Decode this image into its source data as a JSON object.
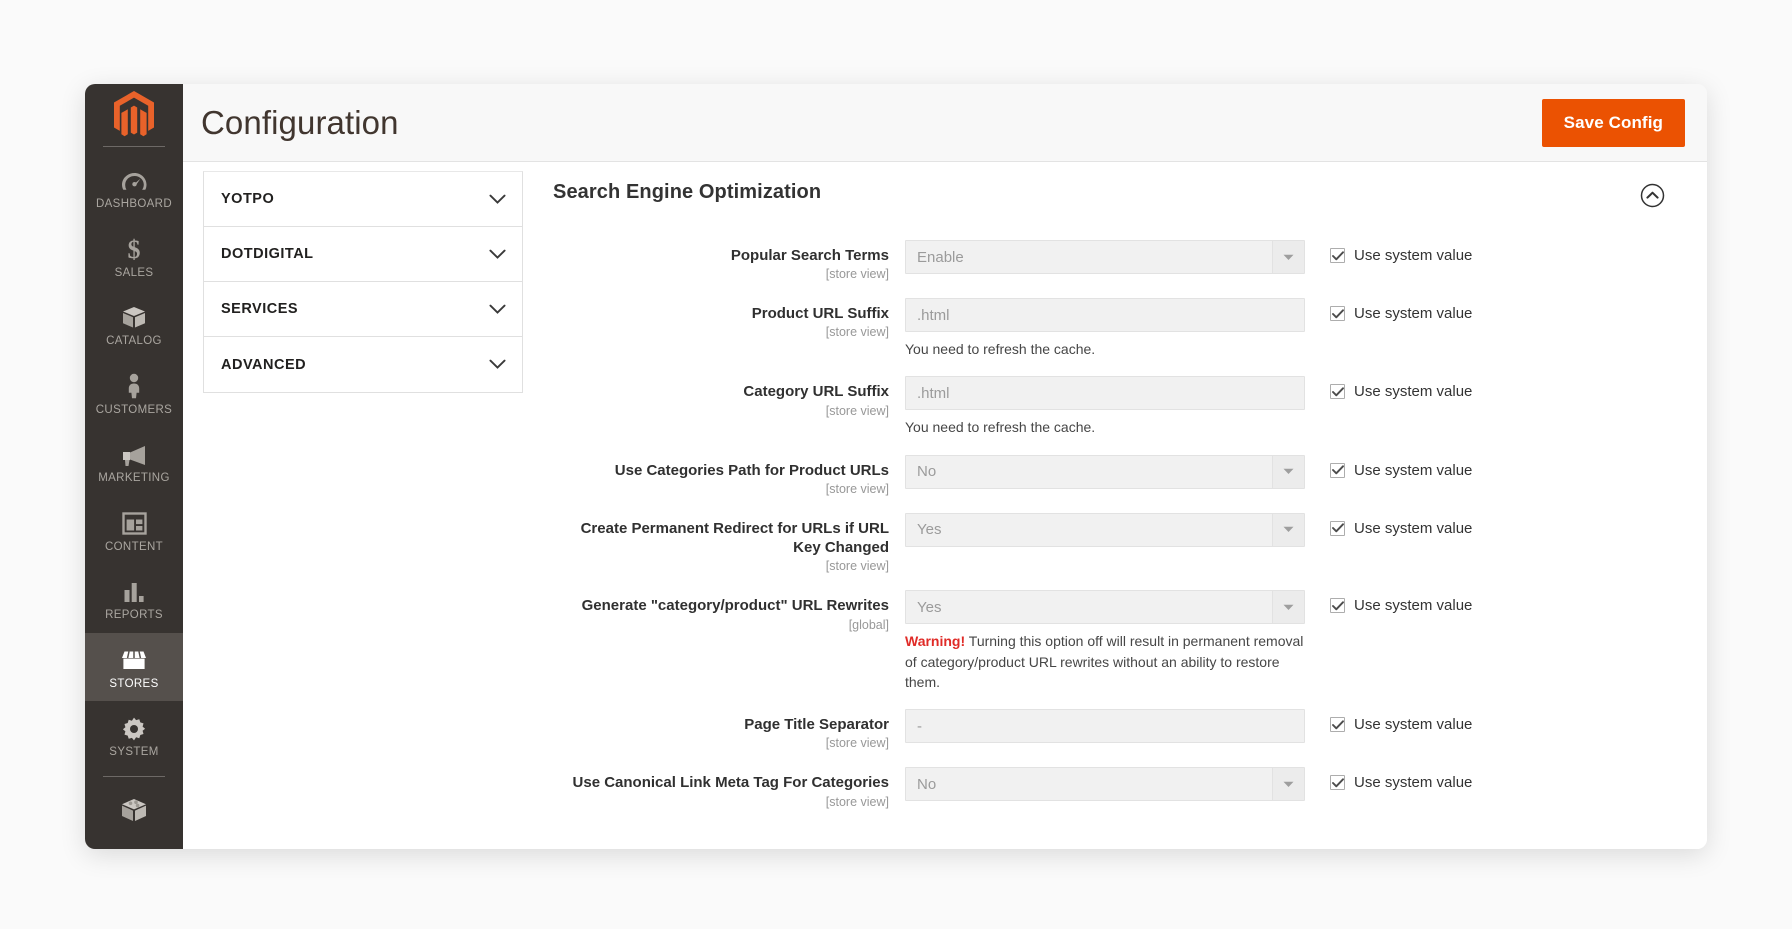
{
  "header": {
    "title": "Configuration",
    "save_label": "Save Config",
    "accent_color": "#eb5202"
  },
  "sidebar": {
    "logo": "magento-logo",
    "items": [
      {
        "label": "DASHBOARD",
        "icon": "dashboard-icon",
        "active": false
      },
      {
        "label": "SALES",
        "icon": "dollar-icon",
        "active": false
      },
      {
        "label": "CATALOG",
        "icon": "box-icon",
        "active": false
      },
      {
        "label": "CUSTOMERS",
        "icon": "person-icon",
        "active": false
      },
      {
        "label": "MARKETING",
        "icon": "megaphone-icon",
        "active": false
      },
      {
        "label": "CONTENT",
        "icon": "layout-icon",
        "active": false
      },
      {
        "label": "REPORTS",
        "icon": "bar-chart-icon",
        "active": false
      },
      {
        "label": "STORES",
        "icon": "store-icon",
        "active": true
      },
      {
        "label": "SYSTEM",
        "icon": "gear-icon",
        "active": false
      }
    ]
  },
  "config_nav": {
    "sections": [
      {
        "label": "YOTPO"
      },
      {
        "label": "DOTDIGITAL"
      },
      {
        "label": "SERVICES"
      },
      {
        "label": "ADVANCED"
      }
    ]
  },
  "content": {
    "section_title": "Search Engine Optimization",
    "collapse_icon": "chevron-up-circle-icon",
    "use_system_value_label": "Use system value",
    "fields": [
      {
        "label": "Popular Search Terms",
        "scope": "[store view]",
        "type": "select",
        "value": "Enable",
        "note": null,
        "note_warning": null,
        "use_system_value": true
      },
      {
        "label": "Product URL Suffix",
        "scope": "[store view]",
        "type": "text",
        "value": ".html",
        "note": "You need to refresh the cache.",
        "note_warning": null,
        "use_system_value": true
      },
      {
        "label": "Category URL Suffix",
        "scope": "[store view]",
        "type": "text",
        "value": ".html",
        "note": "You need to refresh the cache.",
        "note_warning": null,
        "use_system_value": true
      },
      {
        "label": "Use Categories Path for Product URLs",
        "scope": "[store view]",
        "type": "select",
        "value": "No",
        "note": null,
        "note_warning": null,
        "use_system_value": true
      },
      {
        "label": "Create Permanent Redirect for URLs if URL Key Changed",
        "scope": "[store view]",
        "type": "select",
        "value": "Yes",
        "note": null,
        "note_warning": null,
        "use_system_value": true
      },
      {
        "label": "Generate \"category/product\" URL Rewrites",
        "scope": "[global]",
        "type": "select",
        "value": "Yes",
        "note": "Turning this option off will result in permanent removal of category/product URL rewrites without an ability to restore them.",
        "note_warning": "Warning!",
        "use_system_value": true
      },
      {
        "label": "Page Title Separator",
        "scope": "[store view]",
        "type": "text",
        "value": "-",
        "note": null,
        "note_warning": null,
        "use_system_value": true
      },
      {
        "label": "Use Canonical Link Meta Tag For Categories",
        "scope": "[store view]",
        "type": "select",
        "value": "No",
        "note": null,
        "note_warning": null,
        "use_system_value": true
      }
    ]
  }
}
